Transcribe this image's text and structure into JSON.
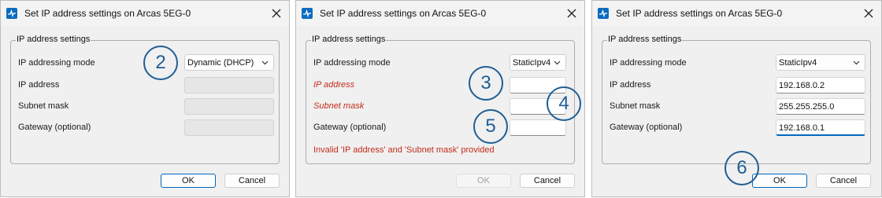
{
  "dialogs": [
    {
      "title": "Set IP address settings on Arcas 5EG-0",
      "group_label": "IP address settings",
      "labels": {
        "mode": "IP addressing mode",
        "ip": "IP address",
        "mask": "Subnet mask",
        "gateway": "Gateway (optional)"
      },
      "mode_value": "Dynamic (DHCP)",
      "ip_value": "",
      "mask_value": "",
      "gateway_value": "",
      "error": "",
      "ok_label": "OK",
      "cancel_label": "Cancel",
      "step": "2"
    },
    {
      "title": "Set IP address settings on Arcas 5EG-0",
      "group_label": "IP address settings",
      "labels": {
        "mode": "IP addressing mode",
        "ip": "IP address",
        "mask": "Subnet mask",
        "gateway": "Gateway (optional)"
      },
      "mode_value": "StaticIpv4",
      "ip_value": "",
      "mask_value": "",
      "gateway_value": "",
      "error": "Invalid 'IP address' and 'Subnet mask' provided",
      "ok_label": "OK",
      "cancel_label": "Cancel",
      "steps": [
        "3",
        "4",
        "5"
      ]
    },
    {
      "title": "Set IP address settings on Arcas 5EG-0",
      "group_label": "IP address settings",
      "labels": {
        "mode": "IP addressing mode",
        "ip": "IP address",
        "mask": "Subnet mask",
        "gateway": "Gateway (optional)"
      },
      "mode_value": "StaticIpv4",
      "ip_value": "192.168.0.2",
      "mask_value": "255.255.255.0",
      "gateway_value": "192.168.0.1",
      "error": "",
      "ok_label": "OK",
      "cancel_label": "Cancel",
      "step": "6"
    }
  ],
  "colors": {
    "accent": "#0067c0",
    "error": "#c42b1c",
    "step_circle": "#1f5e94"
  },
  "icons": [
    "app-icon",
    "close-icon",
    "chevron-down-icon"
  ]
}
